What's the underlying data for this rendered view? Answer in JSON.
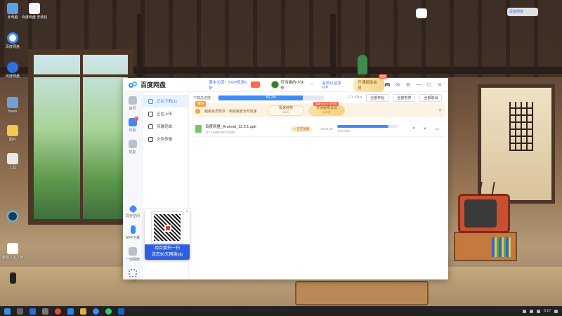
{
  "desktop": {
    "icons": [
      {
        "label": "此电脑"
      },
      {
        "label": "百度网盘"
      },
      {
        "label": "百度网盘"
      },
      {
        "label": "Baidu"
      },
      {
        "label": "图片"
      },
      {
        "label": "新建文本文档"
      },
      {
        "label": "工具"
      }
    ],
    "top_icon_label": "百度网盘 \n安装包"
  },
  "app": {
    "brand_name": "百度网盘",
    "promo_text": "周中大促！SVIP低至6折",
    "username": "叮当猫的小伙伴",
    "vip_link": "会员认证享VIP",
    "vip_button": "开通超级会员",
    "vip_tag": "超值",
    "rail": [
      {
        "label": "首页",
        "icon": "home-icon"
      },
      {
        "label": "传输",
        "icon": "transfer-icon",
        "badge": "1"
      },
      {
        "label": "好友",
        "icon": "friends-icon"
      }
    ],
    "rail_bottom": [
      {
        "label": "同步空间",
        "icon": "sync-icon"
      },
      {
        "label": "APP下载",
        "icon": "phone-icon"
      },
      {
        "label": "一刻相册",
        "icon": "album-icon"
      },
      {
        "label": "工具",
        "icon": "tools-icon"
      }
    ],
    "nav": [
      {
        "label": "正在下载(1)",
        "active": true
      },
      {
        "label": "正在上传",
        "active": false
      },
      {
        "label": "传输完成",
        "active": false
      },
      {
        "label": "文件传输",
        "active": false
      }
    ],
    "toolbar": {
      "label": "下载总进度",
      "percent_text": "80.2%",
      "progress": 0.802,
      "speed": "174 KB/s",
      "buttons": [
        "全部开始",
        "全部暂停",
        "全部取消"
      ]
    },
    "banner": {
      "tag": "限时",
      "text": "超级会员尊享 · 传输速度为你加速",
      "pill1_title": "极速特权",
      "pill1_sub": "¥0/天",
      "pill2_title": "开通超级会员",
      "pill2_sub": "¥25/月",
      "pill2_tag": "超级会员专享特权"
    },
    "file": {
      "name": "百度网盘_Android_12.3.1.apk",
      "size": "117.14MB/300.02MB",
      "boost": "⚡ 正在加速",
      "time": "00:01:28",
      "progress": 0.84,
      "speed": "174 KB/s"
    }
  },
  "qr": {
    "line1": "用百度扫一扫",
    "line2": "送您90天网盘vip"
  },
  "tray": {
    "time": "0:17",
    "date": "",
    "network_label": "百度网盘"
  }
}
